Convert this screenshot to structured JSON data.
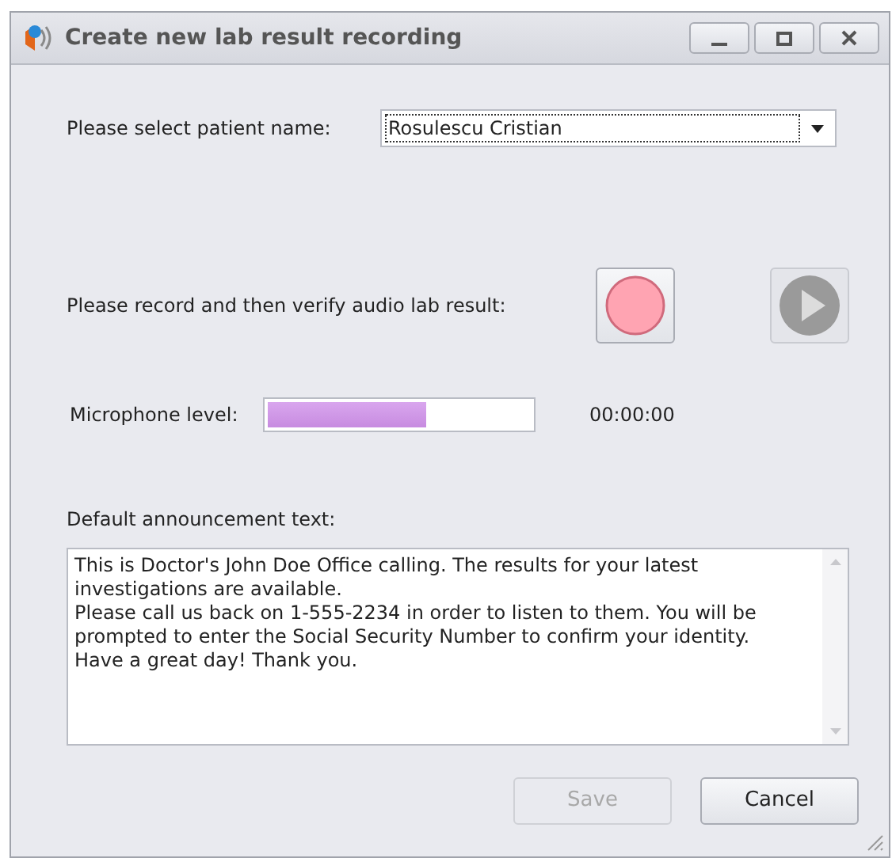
{
  "window": {
    "title": "Create new lab result recording"
  },
  "patient": {
    "label": "Please select patient name:",
    "value": "Rosulescu Cristian"
  },
  "record": {
    "label": "Please record and then verify audio lab result:",
    "play_disabled": true
  },
  "microphone": {
    "label": "Microphone level:",
    "level": 0.6,
    "time": "00:00:00"
  },
  "announcement": {
    "label": "Default announcement text:",
    "text": "This is Doctor's John Doe Office calling. The results for your latest\ninvestigations are available.\nPlease call us back on 1-555-2234 in order to listen to them. You will be\nprompted to enter the Social Security Number to confirm your identity.\nHave a great day! Thank you."
  },
  "buttons": [
    {
      "label": "Save",
      "disabled": true
    },
    {
      "label": "Cancel",
      "disabled": false
    }
  ]
}
